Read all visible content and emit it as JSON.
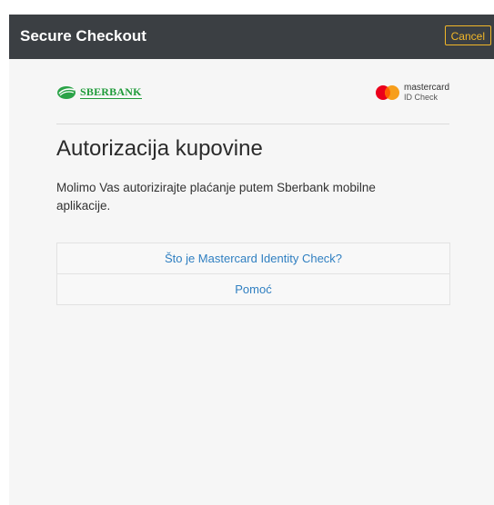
{
  "header": {
    "title": "Secure Checkout",
    "cancel_label": "Cancel"
  },
  "logos": {
    "bank_name": "SBERBANK",
    "card_brand": "mastercard",
    "card_brand_sub": "ID Check"
  },
  "main": {
    "title": "Autorizacija kupovine",
    "description": "Molimo Vas autorizirajte plaćanje putem Sberbank mobilne aplikacije.",
    "links": [
      {
        "label": "Što je Mastercard Identity Check?"
      },
      {
        "label": "Pomoć"
      }
    ]
  },
  "colors": {
    "header_bg": "#3b3f43",
    "cancel_accent": "#f2b728",
    "link": "#2f7fc1",
    "sber_green": "#1f9b3a",
    "mc_red": "#eb001b",
    "mc_orange": "#f79e1b"
  },
  "icons": {
    "bank_logo": "sberbank-logo-icon",
    "card_logo": "mastercard-logo-icon"
  }
}
